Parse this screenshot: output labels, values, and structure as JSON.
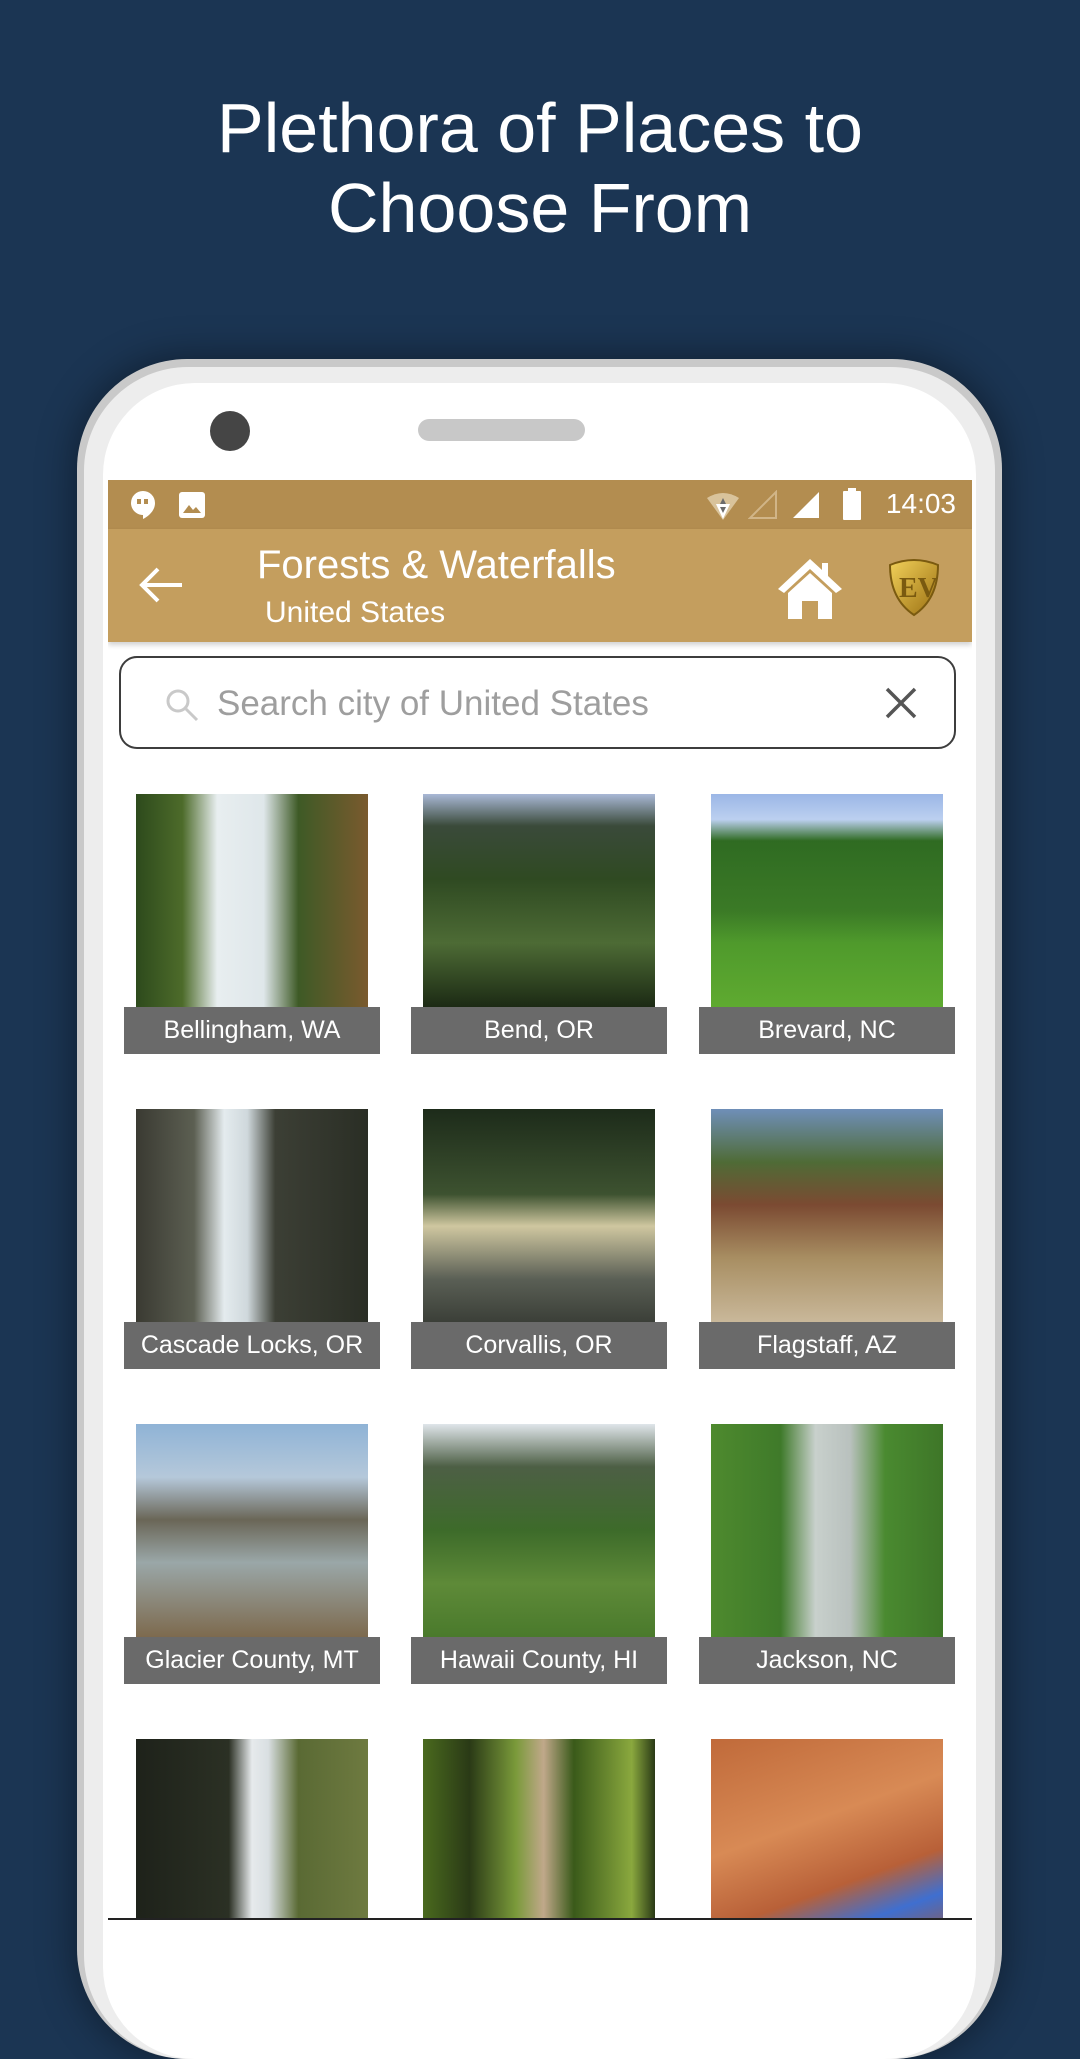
{
  "promo": {
    "headline_line1": "Plethora of Places to",
    "headline_line2": "Choose From"
  },
  "status_bar": {
    "left_icons": [
      "hangouts-icon",
      "image-icon"
    ],
    "right_icons": [
      "wifi-icon",
      "signal-empty-icon",
      "signal-icon",
      "battery-icon"
    ],
    "time": "14:03"
  },
  "toolbar": {
    "title": "Forests & Waterfalls",
    "subtitle": "United States",
    "back_icon": "arrow-left-icon",
    "home_icon": "home-icon",
    "logo_text": "EV"
  },
  "search": {
    "placeholder": "Search city of United States",
    "value": ""
  },
  "colors": {
    "background": "#1b3553",
    "status_bar": "#b38d50",
    "toolbar": "#c49e5e",
    "label_bg": "#6a6a6a"
  },
  "places": [
    {
      "name": "Bellingham, WA",
      "scene": "waterfall"
    },
    {
      "name": "Bend, OR",
      "scene": "canyon-falls"
    },
    {
      "name": "Brevard, NC",
      "scene": "golf-lodge"
    },
    {
      "name": "Cascade Locks, OR",
      "scene": "waterfall-cliff"
    },
    {
      "name": "Corvallis, OR",
      "scene": "forest-path"
    },
    {
      "name": "Flagstaff, AZ",
      "scene": "trail-sign"
    },
    {
      "name": "Glacier County, MT",
      "scene": "glacier-valley"
    },
    {
      "name": "Hawaii County, HI",
      "scene": "tropical-falls"
    },
    {
      "name": "Jackson, NC",
      "scene": "cascade-falls"
    },
    {
      "name": "",
      "scene": "tall-waterfall"
    },
    {
      "name": "",
      "scene": "bamboo-forest"
    },
    {
      "name": "",
      "scene": "rock-arch"
    }
  ]
}
